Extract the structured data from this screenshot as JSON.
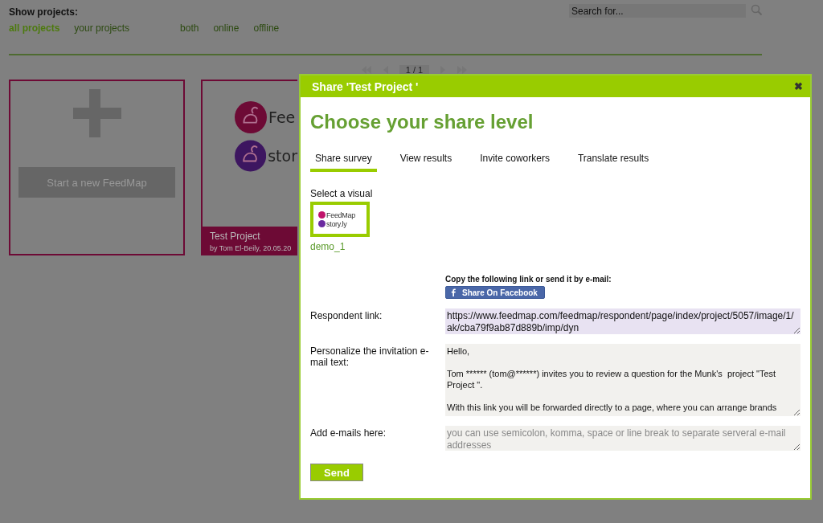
{
  "filter_bar": {
    "title": "Show projects:",
    "filters": [
      {
        "label": "all projects",
        "selected": true
      },
      {
        "label": "your projects",
        "selected": false
      },
      {
        "label": "both",
        "selected": false
      },
      {
        "label": "online",
        "selected": false
      },
      {
        "label": "offline",
        "selected": false
      }
    ],
    "search": {
      "placeholder": "Search for..."
    }
  },
  "pager": {
    "page": "1 / 1"
  },
  "cards": [
    {
      "kind": "new",
      "button": "Start a new FeedMap"
    },
    {
      "kind": "project",
      "logo_lines": [
        "Fee",
        "stor"
      ],
      "title": "Test Project",
      "byline": "by Tom El-Beily, 20.05.20"
    }
  ],
  "dialog": {
    "title": "Share 'Test Project '",
    "close": "✖",
    "heading": "Choose your share level",
    "tabs": [
      {
        "label": "Share survey",
        "selected": true
      },
      {
        "label": "View results",
        "selected": false
      },
      {
        "label": "Invite coworkers",
        "selected": false
      },
      {
        "label": "Translate results",
        "selected": false
      }
    ],
    "visual_label": "Select a visual",
    "visual": {
      "name": "demo_1",
      "selected": true,
      "logo_lines": [
        "FeedMap",
        "story.ly"
      ]
    },
    "copy_hint": "Copy the following link or send it by e-mail:",
    "facebook_button": "Share On Facebook",
    "fields": [
      {
        "label": "Respondent link:",
        "value": "https://www.feedmap.com/feedmap/respondent/page/index/project/5057/image/1/ak/cba79f9ab87d889b/imp/dyn",
        "highlighted": true
      },
      {
        "label": "Personalize the invitation e-mail text:",
        "value": "Hello,\n\nTom ****** (tom@******) invites you to review a question for the Munk's  project \"Test Project \".\n\nWith this link you will be forwarded directly to a page, where you can arrange brands",
        "highlighted": false
      },
      {
        "label": "Add e-mails here:",
        "placeholder": "you can use semicolon, komma, space or line break to separate serveral e-mail addresses",
        "highlighted": false
      }
    ],
    "send_button": "Send"
  }
}
